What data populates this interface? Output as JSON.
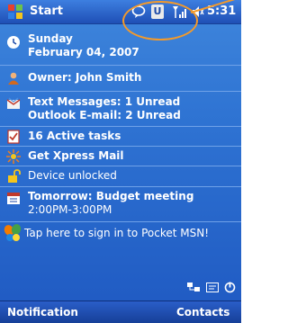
{
  "titlebar": {
    "app": "Start",
    "u_glyph": "U",
    "time": "5:31",
    "icons": [
      "windows-flag-icon",
      "message-icon",
      "usb-icon",
      "signal-icon",
      "volume-icon"
    ]
  },
  "today": {
    "date": {
      "weekday": "Sunday",
      "date": "February 04, 2007"
    },
    "owner": "Owner: John Smith",
    "messages": {
      "text": "Text Messages: 1 Unread",
      "outlook": "Outlook E-mail: 2 Unread"
    },
    "tasks": "16 Active tasks",
    "xpress": "Get Xpress Mail",
    "lock": "Device unlocked",
    "calendar": {
      "title": "Tomorrow: Budget meeting",
      "time": "2:00PM-3:00PM"
    },
    "msn": "Tap here to sign in to Pocket MSN!"
  },
  "softkeys": {
    "left": "Notification",
    "right": "Contacts"
  },
  "colors": {
    "highlight": "#f39a2b",
    "background": "#2f74d3"
  }
}
